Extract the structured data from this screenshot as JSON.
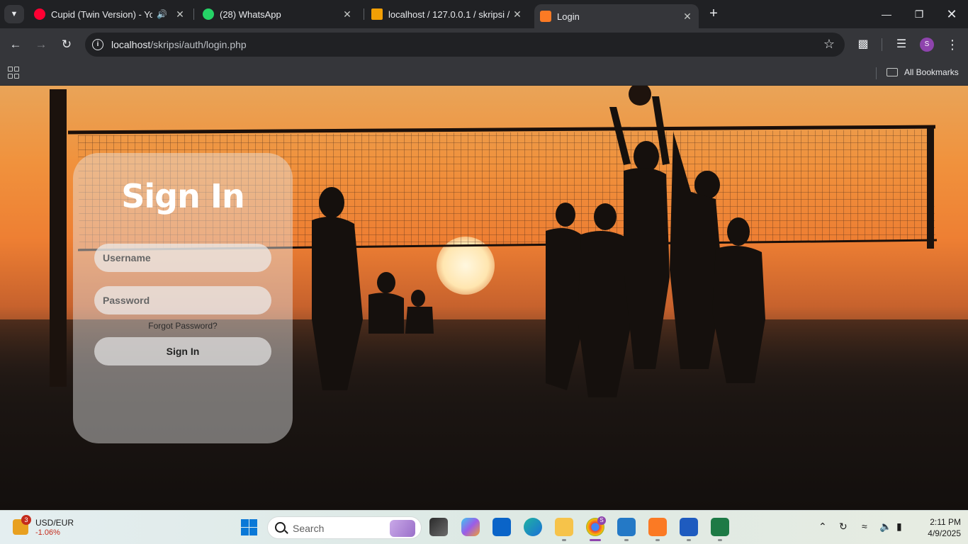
{
  "browser": {
    "tabs": [
      {
        "title": "Cupid (Twin Version) - YouTube",
        "icon": "youtube-icon",
        "audio": true
      },
      {
        "title": "(28) WhatsApp",
        "icon": "whatsapp-icon"
      },
      {
        "title": "localhost / 127.0.0.1 / skripsi / u",
        "icon": "phpmyadmin-icon"
      },
      {
        "title": "Login",
        "icon": "xampp-icon",
        "active": true
      }
    ],
    "url_host": "localhost",
    "url_path": "/skripsi/auth/login.php",
    "profile_initial": "S",
    "bookmarks_label": "All Bookmarks",
    "accent": "#8e44ad"
  },
  "login": {
    "title": "Sign In",
    "username_placeholder": "Username",
    "password_placeholder": "Password",
    "forgot_label": "Forgot Password?",
    "submit_label": "Sign In"
  },
  "taskbar": {
    "ticker_name": "USD/EUR",
    "ticker_change": "-1.06%",
    "ticker_badge": "3",
    "search_label": "Search",
    "time": "2:11 PM",
    "date": "4/9/2025",
    "chrome_badge": "S"
  }
}
